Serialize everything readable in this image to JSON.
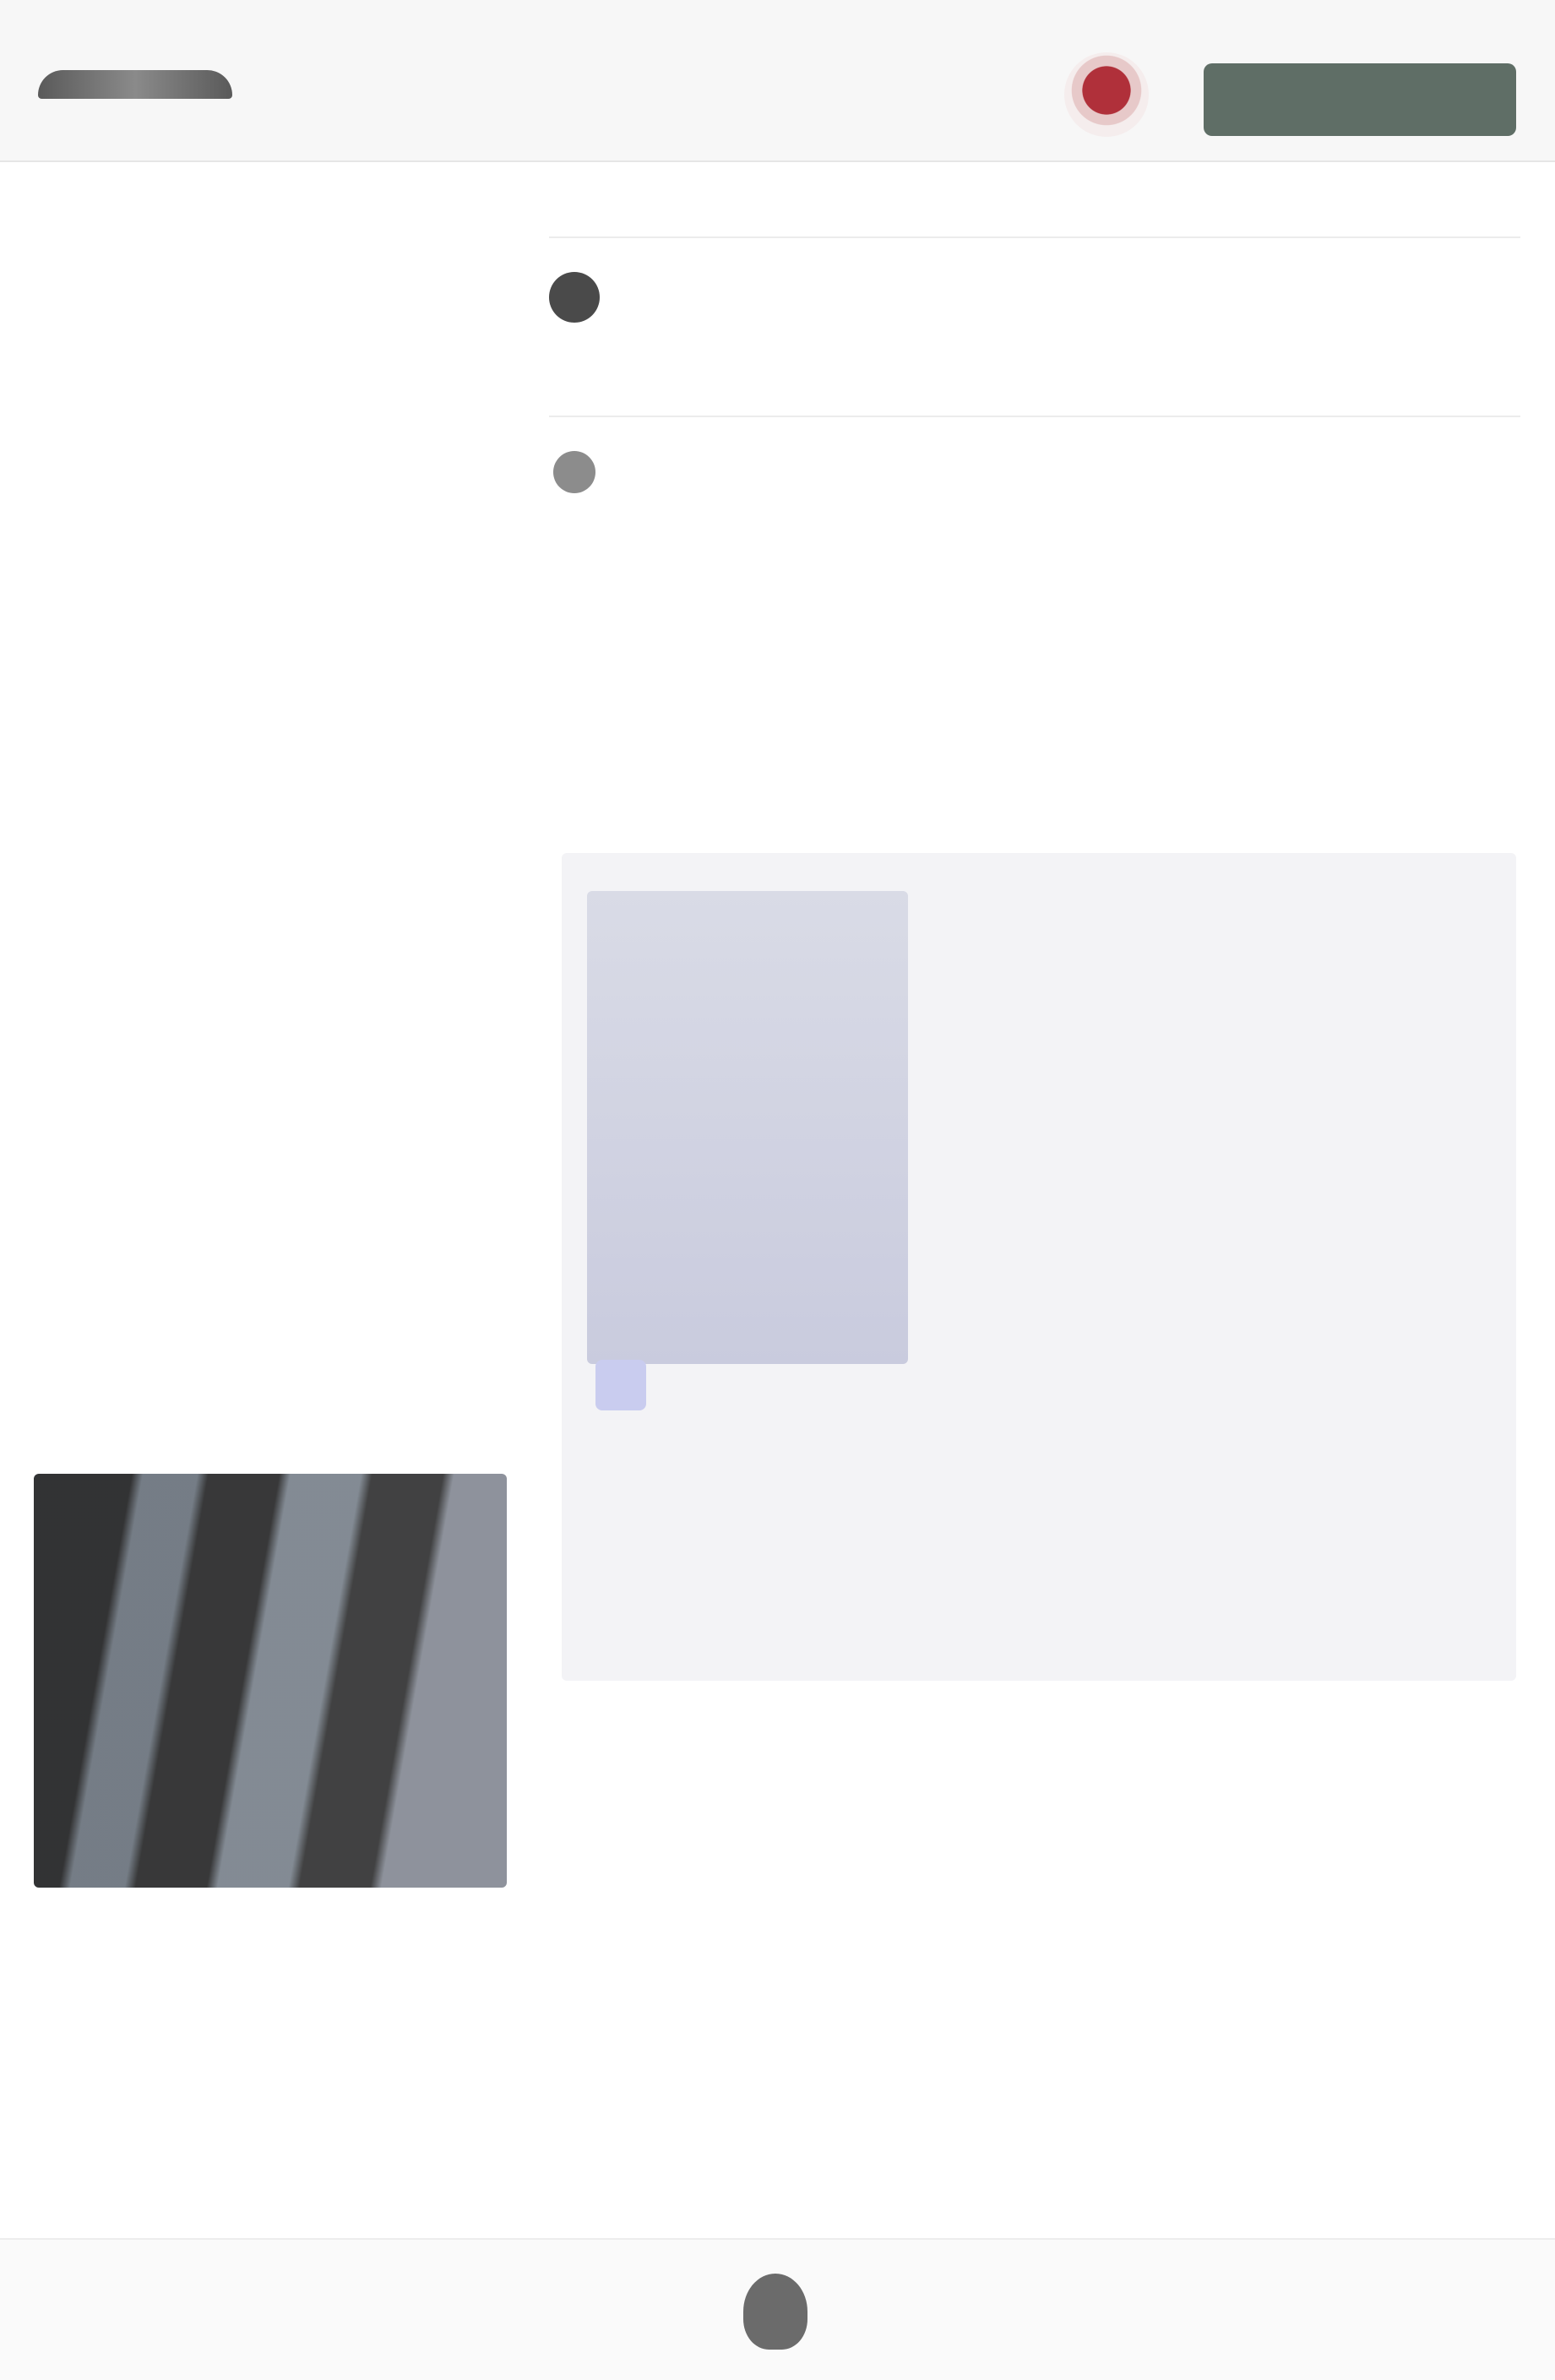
{
  "header": {
    "logo_text": "",
    "action_button": ""
  },
  "main": {
    "section_label": "",
    "entries": [
      {
        "title": "",
        "lines": [
          "",
          "",
          ""
        ],
        "meta": ""
      },
      {
        "title": "",
        "inline": ""
      }
    ]
  },
  "panel": {
    "links": [
      "",
      "",
      "",
      ""
    ],
    "item": {
      "lead": "",
      "link": "",
      "sub_lines": [
        "",
        ""
      ]
    }
  },
  "footer": {
    "left": "",
    "right": ""
  },
  "colors": {
    "link": "#5a64c8",
    "button": "#5f6e66",
    "flag_red": "#b0303a"
  },
  "icons": [
    "flag-icon",
    "bullet-icon",
    "check-icon",
    "footer-emblem-icon"
  ]
}
